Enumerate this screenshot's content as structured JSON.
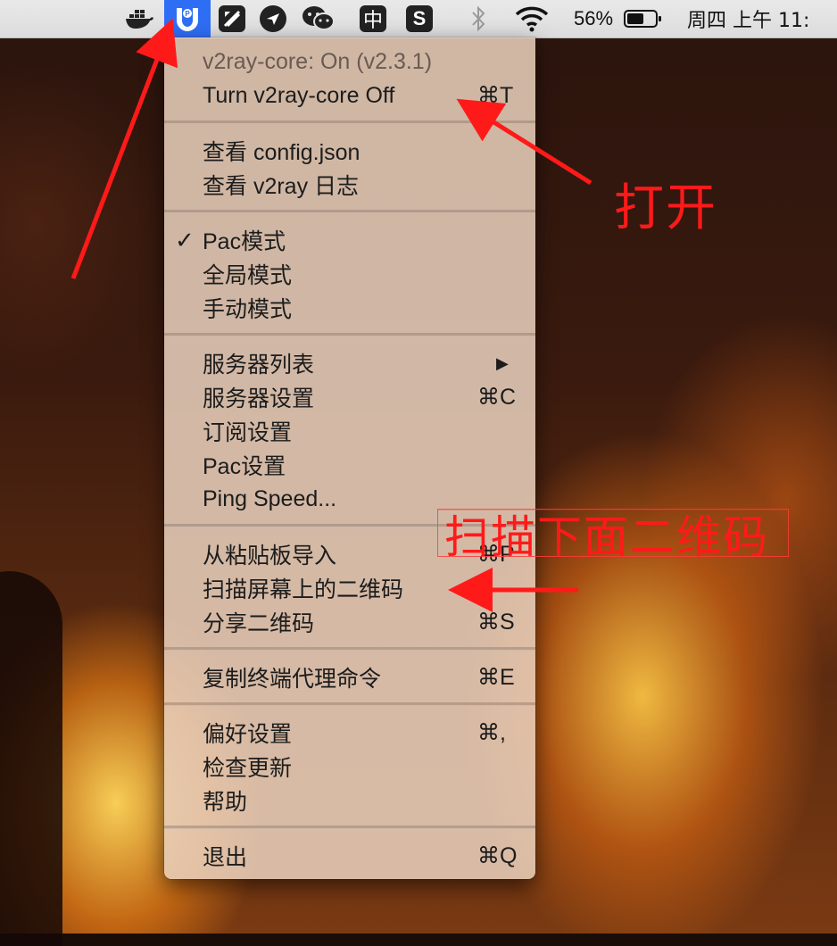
{
  "menubar": {
    "icons": [
      {
        "name": "docker-icon"
      },
      {
        "name": "v2rayu-icon"
      },
      {
        "name": "pen-tablet-icon"
      },
      {
        "name": "bird-chat-icon"
      },
      {
        "name": "wechat-icon"
      },
      {
        "name": "input-method-zhong-icon"
      },
      {
        "name": "sogou-input-icon"
      },
      {
        "name": "bluetooth-icon"
      },
      {
        "name": "wifi-icon"
      },
      {
        "name": "battery-icon"
      }
    ],
    "battery_percent": "56%",
    "ime_label": "中",
    "sogou_label": "S",
    "clock": "周四 上午 11:"
  },
  "menu": {
    "status": "v2ray-core: On  (v2.3.1)",
    "turn_off": {
      "label": "Turn v2ray-core Off",
      "shortcut": "⌘T"
    },
    "view_config": "查看 config.json",
    "view_log": "查看 v2ray 日志",
    "mode_pac": "Pac模式",
    "mode_global": "全局模式",
    "mode_manual": "手动模式",
    "check_mark": "✓",
    "server_list": "服务器列表",
    "submenu_arrow": "▶",
    "server_settings": {
      "label": "服务器设置",
      "shortcut": "⌘C"
    },
    "subscription_settings": "订阅设置",
    "pac_settings": "Pac设置",
    "ping_speed": "Ping Speed...",
    "import_clipboard": {
      "label": "从粘贴板导入",
      "shortcut": "⌘P"
    },
    "scan_qr": "扫描屏幕上的二维码",
    "share_qr": {
      "label": "分享二维码",
      "shortcut": "⌘S"
    },
    "copy_proxy_cmd": {
      "label": "复制终端代理命令",
      "shortcut": "⌘E"
    },
    "preferences": {
      "label": "偏好设置",
      "shortcut": "⌘,"
    },
    "check_updates": "检查更新",
    "help": "帮助",
    "quit": {
      "label": "退出",
      "shortcut": "⌘Q"
    }
  },
  "annotations": {
    "open": "打开",
    "scan_below": "扫描下面二维码",
    "color": "#ff1a1a"
  }
}
